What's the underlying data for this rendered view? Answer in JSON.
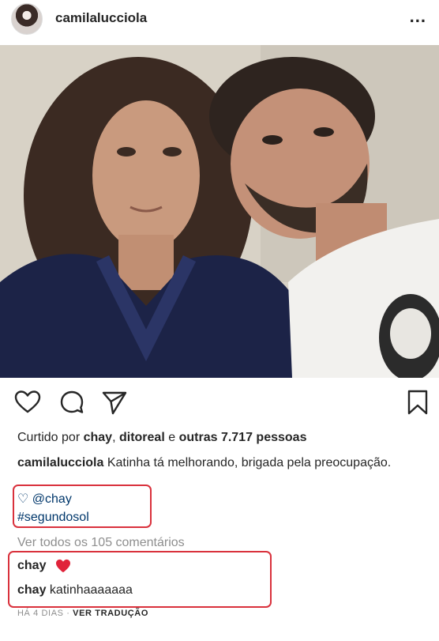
{
  "post": {
    "username": "camilalucciola",
    "more_icon": "more-horizontal-icon",
    "more_label": "..."
  },
  "actions": {
    "like_icon": "heart-outline-icon",
    "comment_icon": "comment-icon",
    "share_icon": "paper-plane-icon",
    "save_icon": "bookmark-icon"
  },
  "likes": {
    "prefix": "Curtido por",
    "user1": "chay",
    "sep": ",",
    "user2": "ditoreal",
    "conj": "e",
    "others": "outras 7.717 pessoas"
  },
  "caption": {
    "author": "camilalucciola",
    "text": "Katinha tá melhorando, brigada pela preocupação.",
    "mention_line": "♡ @chay",
    "hashtag_line": "#segundosol"
  },
  "comments": {
    "view_all": "Ver todos os 105 comentários",
    "items": [
      {
        "author": "chay",
        "text": "",
        "emoji": "red-heart-icon"
      },
      {
        "author": "chay",
        "text": "katinhaaaaaaa"
      }
    ]
  },
  "footer": {
    "time": "HÁ 4 DIAS",
    "dot": "·",
    "see_translation": "VER TRADUÇÃO"
  },
  "colors": {
    "highlight_box": "#d9313c",
    "link": "#00376b",
    "muted": "#8e8e8e",
    "text": "#262626"
  }
}
